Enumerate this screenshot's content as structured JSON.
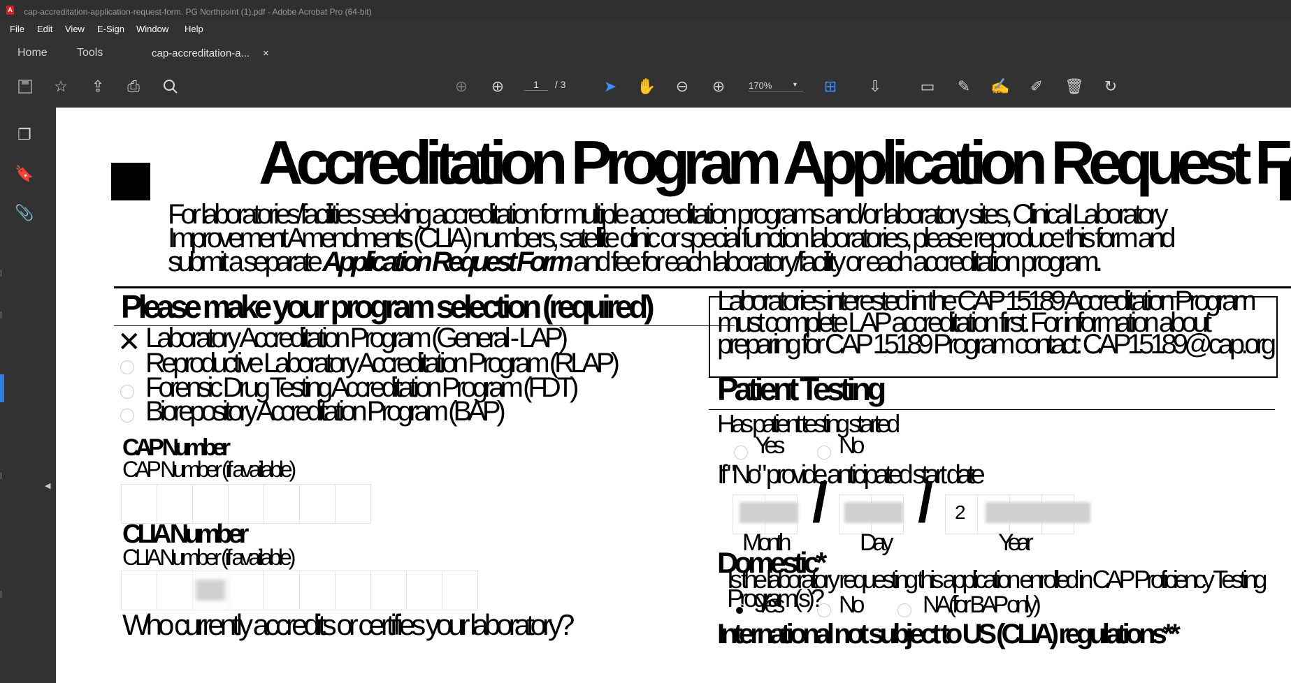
{
  "window": {
    "title": "cap-accreditation-application-request-form. PG Northpoint (1).pdf - Adobe Acrobat Pro (64-bit)"
  },
  "menu": [
    "File",
    "Edit",
    "View",
    "E-Sign",
    "Window",
    "Help"
  ],
  "tabs": {
    "home": "Home",
    "tools": "Tools",
    "doc": "cap-accreditation-a...",
    "close": "×"
  },
  "toolbar": {
    "page_current": "1",
    "page_total": "/ 3",
    "zoom": "170%"
  },
  "doc": {
    "title": "Accreditation Program Application Request Form",
    "intro_1": "For laboratories/facilities seeking accreditation for multiple accreditation programs and/or laboratory sites, Clinical Laboratory",
    "intro_2": "Improvement Amendments (CLIA) numbers, satellite clinic or special function laboratories, please reproduce this form and",
    "intro_3_a": "submit a separate",
    "intro_3_b": "Application Request Form",
    "intro_3_c": "and fee for each laboratory/facility or each accreditation program.",
    "program_heading": "Please make your program selection (required)",
    "programs": [
      {
        "label": "Laboratory Accreditation Program (General - LAP)",
        "selected": true
      },
      {
        "label": "Reproductive Laboratory Accreditation Program (RLAP)",
        "selected": false
      },
      {
        "label": "Forensic Drug Testing Accreditation Program (FDT)",
        "selected": false
      },
      {
        "label": "Biorepository Accreditation Program (BAP)",
        "selected": false
      }
    ],
    "cap_number_heading": "CAP Number",
    "cap_number_label": "CAP Number (if available)",
    "clia_heading": "CLIA Number",
    "clia_label": "CLIA Number (if available)",
    "accredits_question": "Who currently accredits or certifies your laboratory?",
    "note": "Laboratories interested in the CAP 15189 Accreditation Program must complete LAP accreditation first. For information about preparing for CAP 15189 Program contact: CAP15189@cap.org",
    "patient_heading": "Patient Testing",
    "patient_question": "Has patient testing started",
    "yes": "Yes",
    "no": "No",
    "start_date_label": "If \"No\" provide anticipated start date",
    "year_prefix": "2",
    "month": "Month",
    "day": "Day",
    "year": "Year",
    "domestic_heading": "Domestic*",
    "domestic_question": "Is the laboratory requesting this application enrolled in CAP Proficiency Testing Program(s)?",
    "na_bap": "NA (for BAP only)",
    "international_heading": "International not subject to US (CLIA) regulations**"
  }
}
